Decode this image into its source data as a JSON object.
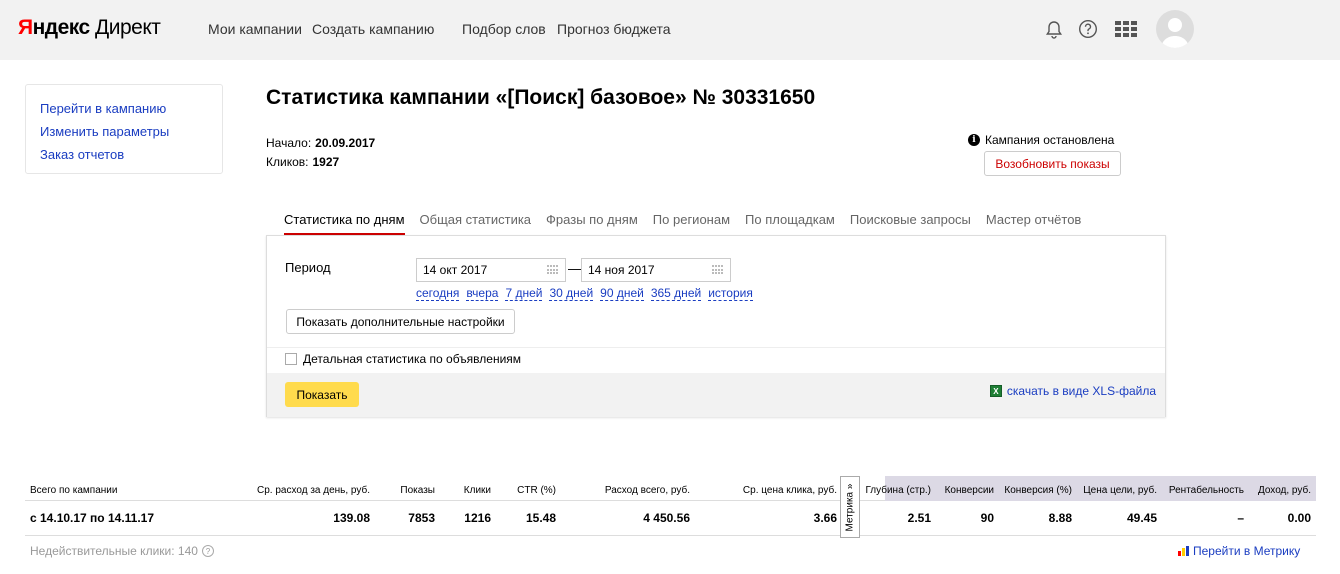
{
  "header": {
    "logo_brand": "Яндекс",
    "logo_product": "Директ",
    "nav": [
      "Мои кампании",
      "Создать кампанию",
      "Подбор слов",
      "Прогноз бюджета"
    ]
  },
  "sidebar": {
    "links": [
      "Перейти в кампанию",
      "Изменить параметры",
      "Заказ отчетов"
    ]
  },
  "page": {
    "title": "Статистика кампании «[Поиск] базовое» № 30331650",
    "start_label": "Начало:",
    "start_value": "20.09.2017",
    "clicks_label": "Кликов:",
    "clicks_value": "1927",
    "status_text": "Кампания остановлена",
    "resume_label": "Возобновить показы"
  },
  "tabs": [
    "Статистика по дням",
    "Общая статистика",
    "Фразы по дням",
    "По регионам",
    "По площадкам",
    "Поисковые запросы",
    "Мастер отчётов"
  ],
  "filters": {
    "period_label": "Период",
    "date_from": "14 окт 2017",
    "date_to": "14 ноя 2017",
    "quick_ranges": [
      "сегодня",
      "вчера",
      "7 дней",
      "30 дней",
      "90 дней",
      "365 дней",
      "история"
    ],
    "extra_settings_label": "Показать дополнительные настройки",
    "detail_checkbox_label": "Детальная статистика по объявлениям",
    "show_label": "Показать",
    "xls_label": "скачать в виде XLS-файла"
  },
  "table": {
    "headers": [
      "Всего по кампании",
      "Ср. расход за день, руб.",
      "Показы",
      "Клики",
      "CTR (%)",
      "Расход всего, руб.",
      "Ср. цена клика, руб.",
      "Глубина (стр.)",
      "Конверсии",
      "Конверсия (%)",
      "Цена цели, руб.",
      "Рентабельность",
      "Доход, руб."
    ],
    "row": [
      "с 14.10.17 по 14.11.17",
      "139.08",
      "7853",
      "1216",
      "15.48",
      "4 450.56",
      "3.66",
      "2.51",
      "90",
      "8.88",
      "49.45",
      "–",
      "0.00"
    ],
    "metrika_tab_label": "Метрика »"
  },
  "footer": {
    "invalid_clicks": "Недействительные клики: 140",
    "metrika_link": "Перейти в Метрику"
  },
  "colors": {
    "accent": "#cc0000",
    "link": "#1a3dc1",
    "show_button": "#ffdb4d",
    "metrika_header_bg": "#dcd9e5"
  },
  "icons": [
    "bell-icon",
    "help-icon",
    "apps-grid-icon",
    "avatar",
    "info-icon",
    "calendar-icon",
    "xls-file-icon",
    "metrika-bars-icon"
  ]
}
